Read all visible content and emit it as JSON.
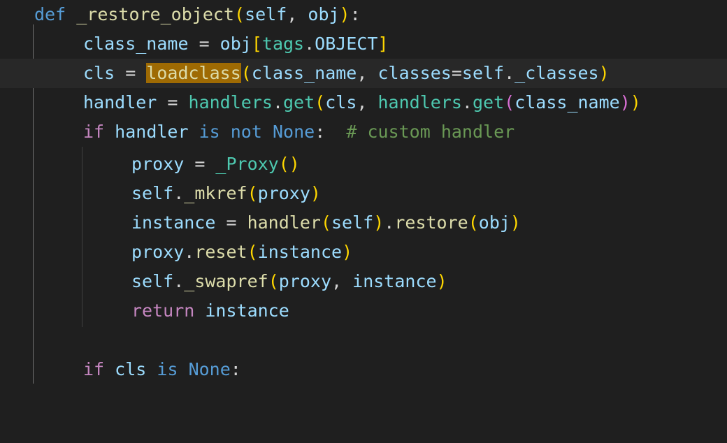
{
  "editor": {
    "lines": [
      {
        "tokens": [
          {
            "t": "def",
            "c": "kw"
          },
          {
            "t": " ",
            "c": "op"
          },
          {
            "t": "_restore_object",
            "c": "fn"
          },
          {
            "t": "(",
            "c": "p1"
          },
          {
            "t": "self",
            "c": "var"
          },
          {
            "t": ", ",
            "c": "op"
          },
          {
            "t": "obj",
            "c": "var"
          },
          {
            "t": ")",
            "c": "p1"
          },
          {
            "t": ":",
            "c": "op"
          }
        ]
      },
      {
        "tokens": [
          {
            "t": "class_name",
            "c": "var"
          },
          {
            "t": " = ",
            "c": "op"
          },
          {
            "t": "obj",
            "c": "var"
          },
          {
            "t": "[",
            "c": "p1"
          },
          {
            "t": "tags",
            "c": "cls"
          },
          {
            "t": ".",
            "c": "op"
          },
          {
            "t": "OBJECT",
            "c": "var"
          },
          {
            "t": "]",
            "c": "p1"
          }
        ]
      },
      {
        "tokens": [
          {
            "t": "cls",
            "c": "var"
          },
          {
            "t": " = ",
            "c": "op"
          },
          {
            "t": "loadclass",
            "c": "hl"
          },
          {
            "t": "(",
            "c": "p1"
          },
          {
            "t": "class_name",
            "c": "var"
          },
          {
            "t": ", ",
            "c": "op"
          },
          {
            "t": "classes",
            "c": "var"
          },
          {
            "t": "=",
            "c": "op"
          },
          {
            "t": "self",
            "c": "var"
          },
          {
            "t": ".",
            "c": "op"
          },
          {
            "t": "_classes",
            "c": "var"
          },
          {
            "t": ")",
            "c": "p1"
          }
        ]
      },
      {
        "tokens": [
          {
            "t": "handler",
            "c": "var"
          },
          {
            "t": " = ",
            "c": "op"
          },
          {
            "t": "handlers",
            "c": "cls"
          },
          {
            "t": ".",
            "c": "op"
          },
          {
            "t": "get",
            "c": "cls"
          },
          {
            "t": "(",
            "c": "p1"
          },
          {
            "t": "cls",
            "c": "var"
          },
          {
            "t": ", ",
            "c": "op"
          },
          {
            "t": "handlers",
            "c": "cls"
          },
          {
            "t": ".",
            "c": "op"
          },
          {
            "t": "get",
            "c": "cls"
          },
          {
            "t": "(",
            "c": "p2"
          },
          {
            "t": "class_name",
            "c": "var"
          },
          {
            "t": ")",
            "c": "p2"
          },
          {
            "t": ")",
            "c": "p1"
          }
        ]
      },
      {
        "tokens": [
          {
            "t": "if",
            "c": "ctrl"
          },
          {
            "t": " ",
            "c": "op"
          },
          {
            "t": "handler",
            "c": "var"
          },
          {
            "t": " ",
            "c": "op"
          },
          {
            "t": "is not",
            "c": "kw"
          },
          {
            "t": " ",
            "c": "op"
          },
          {
            "t": "None",
            "c": "kw"
          },
          {
            "t": ":",
            "c": "op"
          },
          {
            "t": "  ",
            "c": "op"
          },
          {
            "t": "# custom handler",
            "c": "cmt"
          }
        ]
      },
      {
        "tokens": [
          {
            "t": "proxy",
            "c": "var"
          },
          {
            "t": " = ",
            "c": "op"
          },
          {
            "t": "_Proxy",
            "c": "cls"
          },
          {
            "t": "()",
            "c": "p1"
          }
        ]
      },
      {
        "tokens": [
          {
            "t": "self",
            "c": "var"
          },
          {
            "t": ".",
            "c": "op"
          },
          {
            "t": "_mkref",
            "c": "fn"
          },
          {
            "t": "(",
            "c": "p1"
          },
          {
            "t": "proxy",
            "c": "var"
          },
          {
            "t": ")",
            "c": "p1"
          }
        ]
      },
      {
        "tokens": [
          {
            "t": "instance",
            "c": "var"
          },
          {
            "t": " = ",
            "c": "op"
          },
          {
            "t": "handler",
            "c": "fn"
          },
          {
            "t": "(",
            "c": "p1"
          },
          {
            "t": "self",
            "c": "var"
          },
          {
            "t": ")",
            "c": "p1"
          },
          {
            "t": ".",
            "c": "op"
          },
          {
            "t": "restore",
            "c": "fn"
          },
          {
            "t": "(",
            "c": "p1"
          },
          {
            "t": "obj",
            "c": "var"
          },
          {
            "t": ")",
            "c": "p1"
          }
        ]
      },
      {
        "tokens": [
          {
            "t": "proxy",
            "c": "var"
          },
          {
            "t": ".",
            "c": "op"
          },
          {
            "t": "reset",
            "c": "fn"
          },
          {
            "t": "(",
            "c": "p1"
          },
          {
            "t": "instance",
            "c": "var"
          },
          {
            "t": ")",
            "c": "p1"
          }
        ]
      },
      {
        "tokens": [
          {
            "t": "self",
            "c": "var"
          },
          {
            "t": ".",
            "c": "op"
          },
          {
            "t": "_swapref",
            "c": "fn"
          },
          {
            "t": "(",
            "c": "p1"
          },
          {
            "t": "proxy",
            "c": "var"
          },
          {
            "t": ", ",
            "c": "op"
          },
          {
            "t": "instance",
            "c": "var"
          },
          {
            "t": ")",
            "c": "p1"
          }
        ]
      },
      {
        "tokens": [
          {
            "t": "return",
            "c": "ctrl"
          },
          {
            "t": " ",
            "c": "op"
          },
          {
            "t": "instance",
            "c": "var"
          }
        ]
      },
      {
        "tokens": []
      },
      {
        "tokens": [
          {
            "t": "if",
            "c": "ctrl"
          },
          {
            "t": " ",
            "c": "op"
          },
          {
            "t": "cls",
            "c": "var"
          },
          {
            "t": " ",
            "c": "op"
          },
          {
            "t": "is",
            "c": "kw"
          },
          {
            "t": " ",
            "c": "op"
          },
          {
            "t": "None",
            "c": "kw"
          },
          {
            "t": ":",
            "c": "op"
          }
        ]
      }
    ]
  },
  "colors": {
    "background": "#1f1f1f",
    "current_line": "#282828",
    "word_highlight": "#9e6a03",
    "keyword": "#569cd6",
    "control": "#c586c0",
    "function": "#dcdcaa",
    "variable": "#9cdcfe",
    "comment": "#6a9955",
    "class": "#4ec9b0",
    "bracket_1": "#ffd700",
    "bracket_2": "#da70d6"
  }
}
